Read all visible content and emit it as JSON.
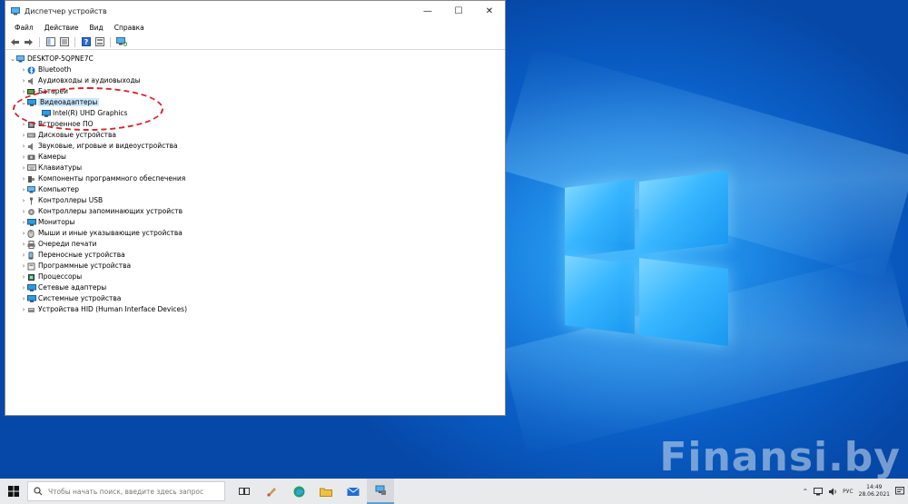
{
  "window": {
    "title": "Диспетчер устройств",
    "controls": {
      "minimize": "—",
      "maximize": "☐",
      "close": "✕"
    }
  },
  "menu": [
    "Файл",
    "Действие",
    "Вид",
    "Справка"
  ],
  "tree": {
    "root": "DESKTOP-5QPNE7C",
    "items": [
      {
        "label": "Bluetooth",
        "icon": "bluetooth-icon",
        "expanded": false
      },
      {
        "label": "Аудиовходы и аудиовыходы",
        "icon": "speaker-icon",
        "expanded": false
      },
      {
        "label": "Батареи",
        "icon": "battery-icon",
        "expanded": false
      },
      {
        "label": "Видеоадаптеры",
        "icon": "display-adapter-icon",
        "expanded": true,
        "selected": true,
        "children": [
          {
            "label": "Intel(R) UHD Graphics",
            "icon": "display-adapter-icon"
          }
        ]
      },
      {
        "label": "Встроенное ПО",
        "icon": "firmware-icon",
        "expanded": false
      },
      {
        "label": "Дисковые устройства",
        "icon": "disk-icon",
        "expanded": false
      },
      {
        "label": "Звуковые, игровые и видеоустройства",
        "icon": "sound-icon",
        "expanded": false
      },
      {
        "label": "Камеры",
        "icon": "camera-icon",
        "expanded": false
      },
      {
        "label": "Клавиатуры",
        "icon": "keyboard-icon",
        "expanded": false
      },
      {
        "label": "Компоненты программного обеспечения",
        "icon": "software-component-icon",
        "expanded": false
      },
      {
        "label": "Компьютер",
        "icon": "computer-icon",
        "expanded": false
      },
      {
        "label": "Контроллеры USB",
        "icon": "usb-icon",
        "expanded": false
      },
      {
        "label": "Контроллеры запоминающих устройств",
        "icon": "storage-controller-icon",
        "expanded": false
      },
      {
        "label": "Мониторы",
        "icon": "monitor-icon",
        "expanded": false
      },
      {
        "label": "Мыши и иные указывающие устройства",
        "icon": "mouse-icon",
        "expanded": false
      },
      {
        "label": "Очереди печати",
        "icon": "printer-icon",
        "expanded": false
      },
      {
        "label": "Переносные устройства",
        "icon": "portable-device-icon",
        "expanded": false
      },
      {
        "label": "Программные устройства",
        "icon": "software-device-icon",
        "expanded": false
      },
      {
        "label": "Процессоры",
        "icon": "processor-icon",
        "expanded": false
      },
      {
        "label": "Сетевые адаптеры",
        "icon": "network-adapter-icon",
        "expanded": false
      },
      {
        "label": "Системные устройства",
        "icon": "system-device-icon",
        "expanded": false
      },
      {
        "label": "Устройства HID (Human Interface Devices)",
        "icon": "hid-icon",
        "expanded": false
      }
    ]
  },
  "taskbar": {
    "search_placeholder": "Чтобы начать поиск, введите здесь запрос",
    "apps": [
      "task-view-icon",
      "paint-icon",
      "edge-icon",
      "explorer-icon",
      "mail-icon",
      "device-manager-icon"
    ],
    "tray": {
      "language": "РУС",
      "time": "14:49",
      "date": "28.06.2021"
    }
  },
  "watermark": "Finansi.by",
  "colors": {
    "selection": "#cce8ff",
    "highlight_ellipse": "#d6252b",
    "taskbar": "#e9eaec",
    "accent": "#0078d7"
  }
}
